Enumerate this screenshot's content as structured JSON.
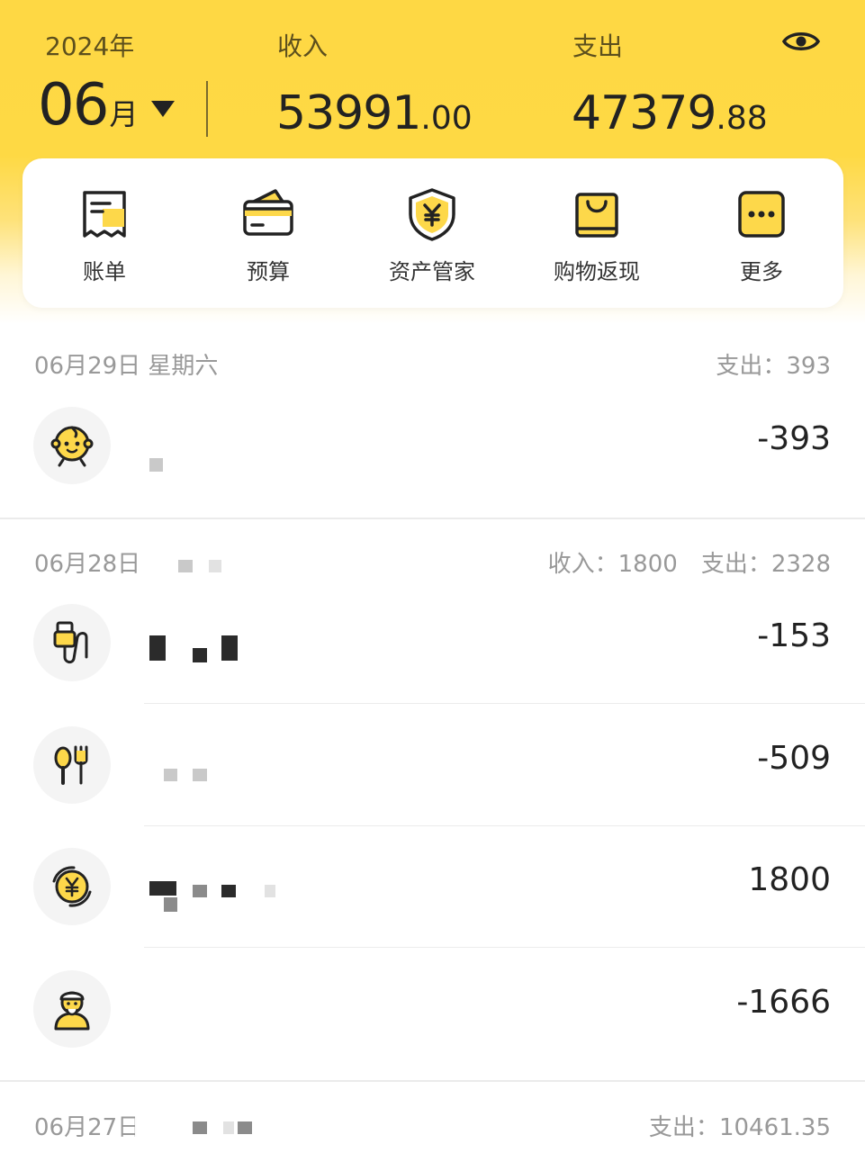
{
  "header": {
    "year": "2024年",
    "month_num": "06",
    "month_unit": "月",
    "income_label": "收入",
    "expense_label": "支出",
    "income_int": "53991",
    "income_dec": ".00",
    "expense_int": "47379",
    "expense_dec": ".88"
  },
  "toolbar": [
    {
      "label": "账单",
      "icon": "bill-icon"
    },
    {
      "label": "预算",
      "icon": "wallet-icon"
    },
    {
      "label": "资产管家",
      "icon": "yen-shield-icon"
    },
    {
      "label": "购物返现",
      "icon": "shopping-bag-icon"
    },
    {
      "label": "更多",
      "icon": "more-icon"
    }
  ],
  "sections": [
    {
      "date": "06月29日  星期六",
      "summary": {
        "expense_label": "支出：",
        "expense": "393"
      },
      "items": [
        {
          "icon": "baby-face-icon",
          "amount": "-393"
        }
      ]
    },
    {
      "date": "06月28日",
      "summary": {
        "income_label": "收入：",
        "income": "1800",
        "expense_label": "支出：",
        "expense": "2328"
      },
      "items": [
        {
          "icon": "usb-charger-icon",
          "amount": "-153"
        },
        {
          "icon": "spoon-fork-icon",
          "amount": "-509"
        },
        {
          "icon": "yen-exchange-icon",
          "amount": "1800"
        },
        {
          "icon": "elder-person-icon",
          "amount": "-1666"
        }
      ]
    },
    {
      "date": "06月27日",
      "summary": {
        "expense_label": "支出：",
        "expense": "10461.35"
      }
    }
  ],
  "colors": {
    "brand_yellow": "#fed844",
    "icon_yellow": "#fdd84a",
    "text_dark": "#222222",
    "text_muted": "#999999"
  }
}
